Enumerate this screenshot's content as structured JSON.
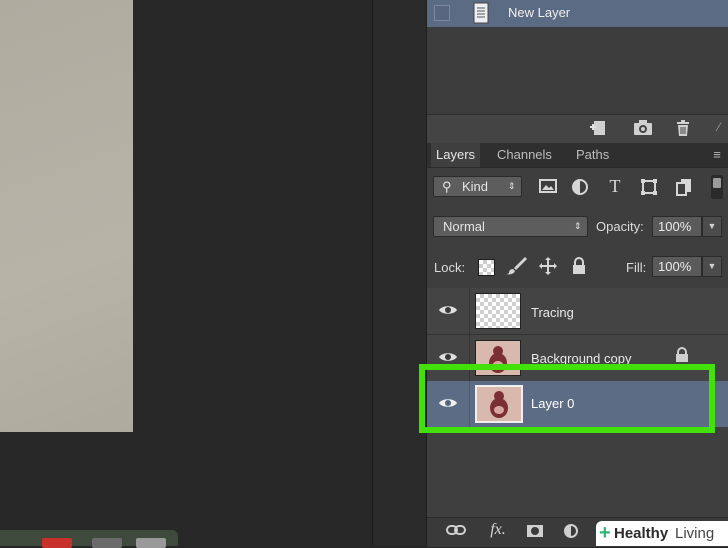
{
  "history": {
    "item_label": "New Layer"
  },
  "tabs": [
    {
      "label": "Layers",
      "active": true
    },
    {
      "label": "Channels",
      "active": false
    },
    {
      "label": "Paths",
      "active": false
    }
  ],
  "filter": {
    "kind_label": "Kind"
  },
  "blend": {
    "mode": "Normal",
    "opacity_label": "Opacity:",
    "opacity_value": "100%"
  },
  "lock": {
    "label": "Lock:",
    "fill_label": "Fill:",
    "fill_value": "100%"
  },
  "layers": [
    {
      "name": "Tracing",
      "visible": true,
      "selected": false,
      "locked": false
    },
    {
      "name": "Background copy",
      "visible": true,
      "selected": false,
      "locked": true
    },
    {
      "name": "Layer 0",
      "visible": true,
      "selected": true,
      "locked": false
    }
  ],
  "watermark": {
    "brand": "Healthy",
    "suffix": "Living"
  },
  "colors": {
    "highlight": "#43e10a",
    "selected_row": "#5d6c85",
    "panel_bg": "#3e3e3e"
  }
}
